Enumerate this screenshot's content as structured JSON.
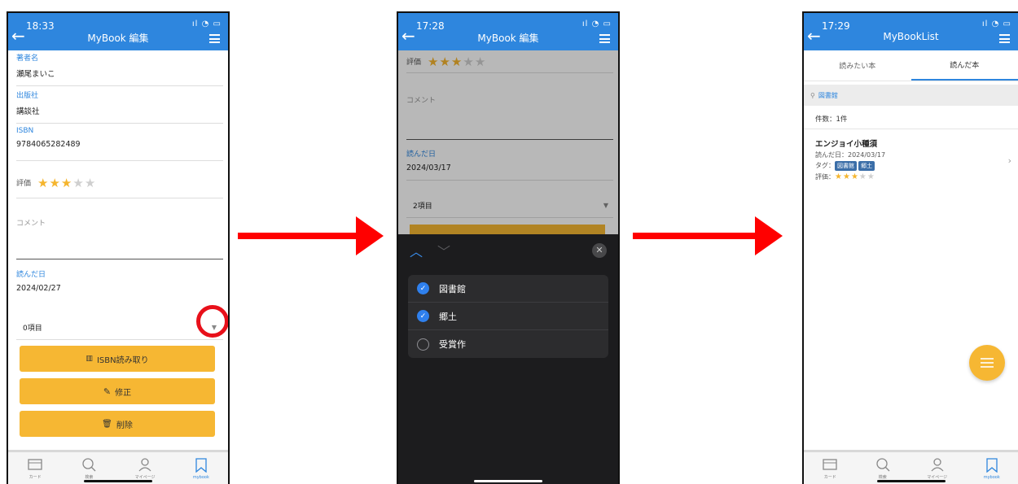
{
  "phone1": {
    "status_time": "18:33",
    "title": "MyBook 編集",
    "fields": [
      {
        "label": "著者名",
        "value": "瀬尾まいこ"
      },
      {
        "label": "出版社",
        "value": "講談社"
      },
      {
        "label": "ISBN",
        "value": "9784065282489"
      }
    ],
    "rating_label": "評価",
    "rating_value": 3,
    "rating_max": 5,
    "comment_label": "コメント",
    "read_date_label": "読んだ日",
    "read_date": "2024/02/27",
    "tag_select": "0項目",
    "buttons": {
      "isbn": "ISBN読み取り",
      "edit": "修正",
      "delete": "削除"
    }
  },
  "phone2": {
    "status_time": "17:28",
    "title": "MyBook 編集",
    "rating_label": "評価",
    "rating_value": 3,
    "comment_label": "コメント",
    "read_date_label": "読んだ日",
    "read_date": "2024/03/17",
    "tag_select": "2項目",
    "close_icon": "✕",
    "options": [
      {
        "label": "図書館",
        "checked": true
      },
      {
        "label": "郷土",
        "checked": true
      },
      {
        "label": "受賞作",
        "checked": false
      }
    ]
  },
  "phone3": {
    "status_time": "17:29",
    "title": "MyBookList",
    "tabs": [
      "読みたい本",
      "読んだ本"
    ],
    "active_tab": 1,
    "search_tag": "図書館",
    "count": "件数：1件",
    "book": {
      "title": "エンジョイ小種須",
      "read_date": "読んだ日：2024/03/17",
      "tags_label": "タグ：",
      "tags": [
        "図書館",
        "郷土"
      ],
      "rating_label": "評価：",
      "rating_value": 3
    }
  },
  "tabbar": [
    {
      "label": "カード"
    },
    {
      "label": "検索"
    },
    {
      "label": "マイページ"
    },
    {
      "label": "mybook"
    }
  ],
  "colors": {
    "header": "#2e86de",
    "button": "#f6b733",
    "arrow": "#ff0000",
    "star": "#f5b52e",
    "check": "#2f80ed"
  }
}
